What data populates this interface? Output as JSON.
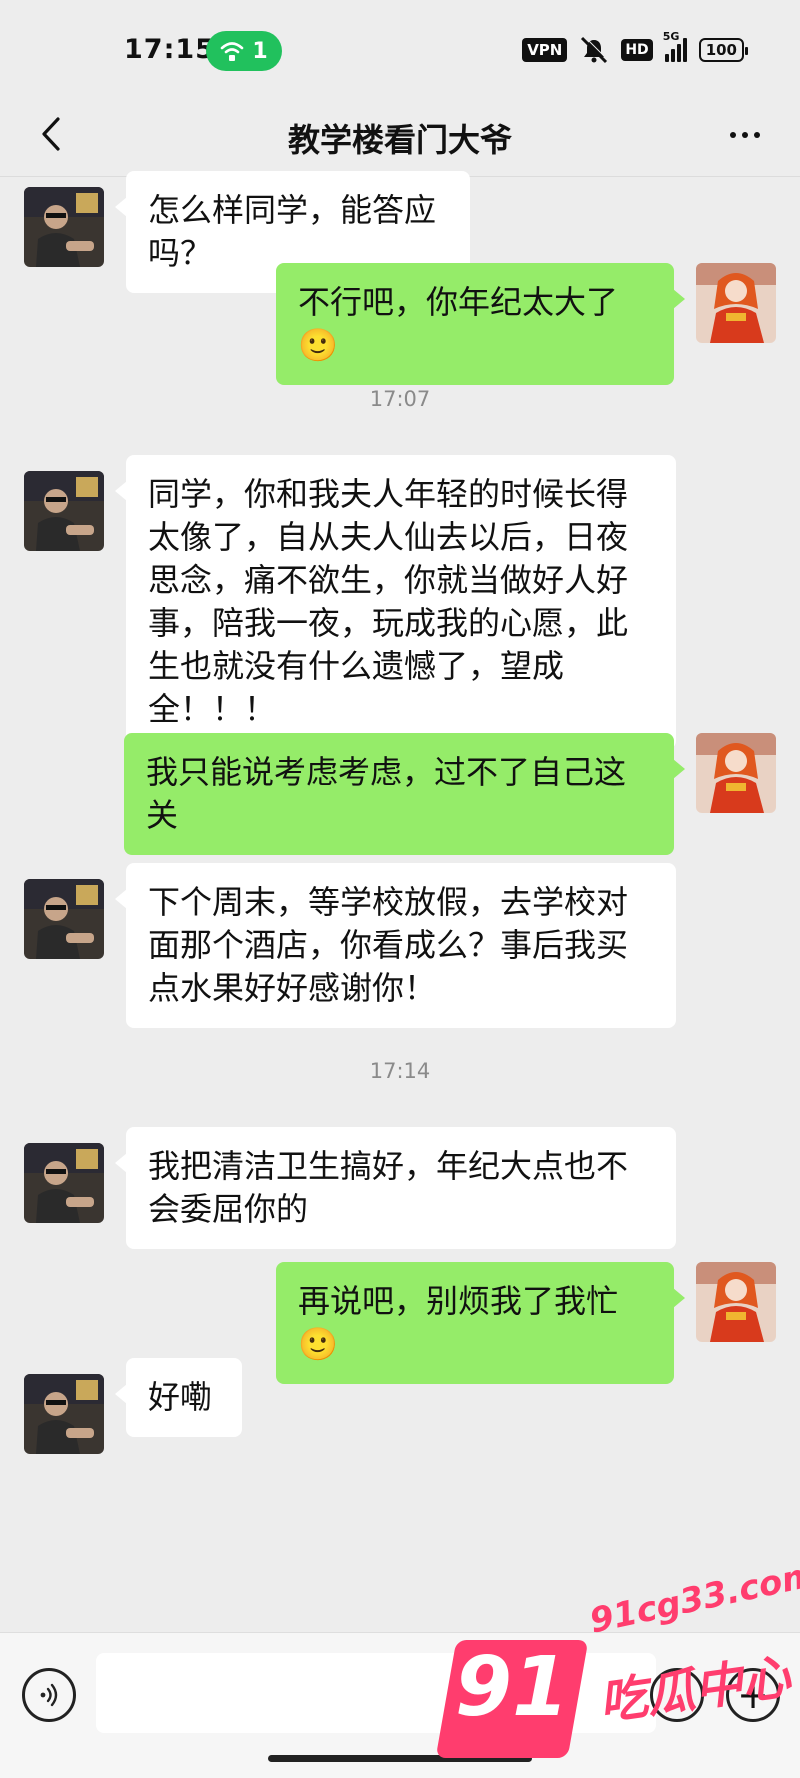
{
  "status_bar": {
    "time": "17:15",
    "hotspot_count": "1",
    "vpn_label": "VPN",
    "hd_label": "HD",
    "network_label": "5G",
    "battery": "100",
    "icons": [
      "hotspot-icon",
      "vpn-icon",
      "mute-icon",
      "hd-icon",
      "signal-icon",
      "battery-icon"
    ]
  },
  "header": {
    "title": "教学楼看门大爷",
    "back_icon": "chevron-left-icon",
    "more_icon": "more-dots-icon"
  },
  "messages": [
    {
      "side": "in",
      "text": "怎么样同学，能答应吗？"
    },
    {
      "side": "out",
      "text": "不行吧，你年纪太大了🙂"
    },
    {
      "type": "timestamp",
      "text": "17:07"
    },
    {
      "side": "in",
      "text": "同学，你和我夫人年轻的时候长得太像了，自从夫人仙去以后，日夜思念，痛不欲生，你就当做好人好事，陪我一夜，玩成我的心愿，此生也就没有什么遗憾了，望成全！！！"
    },
    {
      "side": "out",
      "text": "我只能说考虑考虑，过不了自己这关"
    },
    {
      "side": "in",
      "text": "下个周末，等学校放假，去学校对面那个酒店，你看成么？事后我买点水果好好感谢你！"
    },
    {
      "type": "timestamp",
      "text": "17:14"
    },
    {
      "side": "in",
      "text": "我把清洁卫生搞好，年纪大点也不会委屈你的"
    },
    {
      "side": "out",
      "text": "再说吧，别烦我了我忙🙂"
    },
    {
      "side": "in",
      "text": "好嘞"
    }
  ],
  "input_bar": {
    "voice_icon": "voice-icon",
    "emoji_icon": "emoji-icon",
    "plus_icon": "plus-icon",
    "plus_label": "+"
  },
  "watermark": {
    "url": "91cg33.com",
    "number": "91",
    "name": "吃瓜中心"
  },
  "colors": {
    "background": "#ededed",
    "incoming_bubble": "#ffffff",
    "outgoing_bubble": "#95ec69",
    "hotspot": "#21c15d",
    "watermark": "#ff3d6e"
  }
}
